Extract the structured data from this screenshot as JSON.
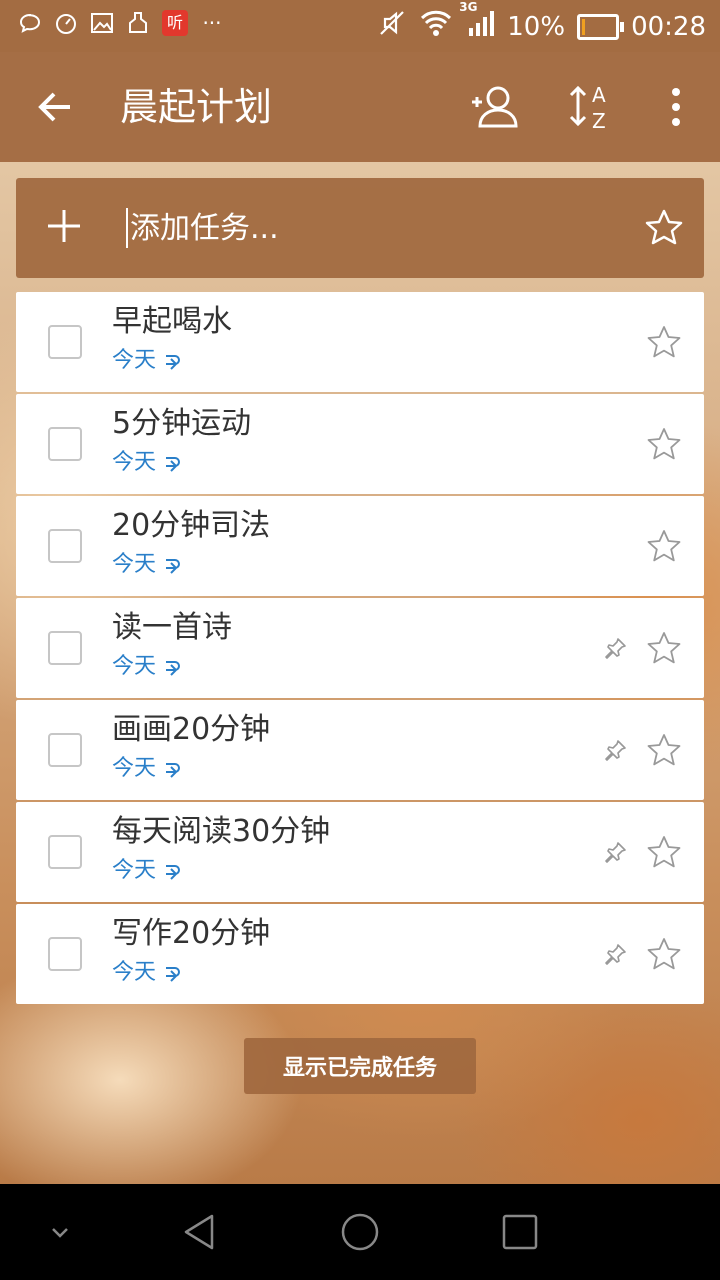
{
  "status_bar": {
    "battery_percent_text": "10%",
    "battery_level": 0.1,
    "network": "3G",
    "time": "00:28",
    "notification_icons": [
      "chat-icon",
      "gauge-icon",
      "image-icon",
      "clean-icon",
      "ting-app-icon",
      "more-dots"
    ],
    "ting_label": "听",
    "more_label": "···"
  },
  "app_bar": {
    "title": "晨起计划",
    "icons": [
      "back-arrow-icon",
      "add-member-icon",
      "sort-az-icon",
      "more-vert-icon"
    ]
  },
  "add_task": {
    "placeholder": "添加任务...",
    "icons": [
      "plus-icon",
      "star-outline-icon"
    ]
  },
  "tasks": [
    {
      "title": "早起喝水",
      "due": "今天",
      "repeat": true,
      "pinned": false,
      "starred": false
    },
    {
      "title": "5分钟运动",
      "due": "今天",
      "repeat": true,
      "pinned": false,
      "starred": false
    },
    {
      "title": "20分钟司法",
      "due": "今天",
      "repeat": true,
      "pinned": false,
      "starred": false
    },
    {
      "title": "读一首诗",
      "due": "今天",
      "repeat": true,
      "pinned": true,
      "starred": false
    },
    {
      "title": "画画20分钟",
      "due": "今天",
      "repeat": true,
      "pinned": true,
      "starred": false
    },
    {
      "title": "每天阅读30分钟",
      "due": "今天",
      "repeat": true,
      "pinned": true,
      "starred": false
    },
    {
      "title": "写作20分钟",
      "due": "今天",
      "repeat": true,
      "pinned": true,
      "starred": false
    }
  ],
  "show_completed_label": "显示已完成任务",
  "colors": {
    "accent": "#a56e45",
    "due_text": "#2a7fc9",
    "task_bg": "#ffffff"
  },
  "nav_bar": {
    "icons": [
      "collapse-chevron-icon",
      "back-triangle-icon",
      "home-circle-icon",
      "recents-square-icon"
    ]
  }
}
